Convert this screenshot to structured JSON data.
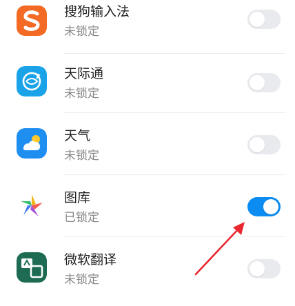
{
  "apps": [
    {
      "name": "搜狗输入法",
      "status": "未锁定",
      "locked": false,
      "icon": "sogou-input-icon",
      "color": "#f26a24"
    },
    {
      "name": "天际通",
      "status": "未锁定",
      "locked": false,
      "icon": "skytone-globe-icon",
      "color": "#1aa3e8"
    },
    {
      "name": "天气",
      "status": "未锁定",
      "locked": false,
      "icon": "weather-sun-cloud-icon",
      "color": "#1e8ef0"
    },
    {
      "name": "图库",
      "status": "已锁定",
      "locked": true,
      "icon": "gallery-pinwheel-icon",
      "color": "#f0b51c"
    },
    {
      "name": "微软翻译",
      "status": "未锁定",
      "locked": false,
      "icon": "microsoft-translator-icon",
      "color": "#1c6b52"
    }
  ],
  "colors": {
    "toggle_on": "#0a8cf2",
    "toggle_off": "#e9eaee",
    "annotation_arrow": "#e8272e"
  }
}
